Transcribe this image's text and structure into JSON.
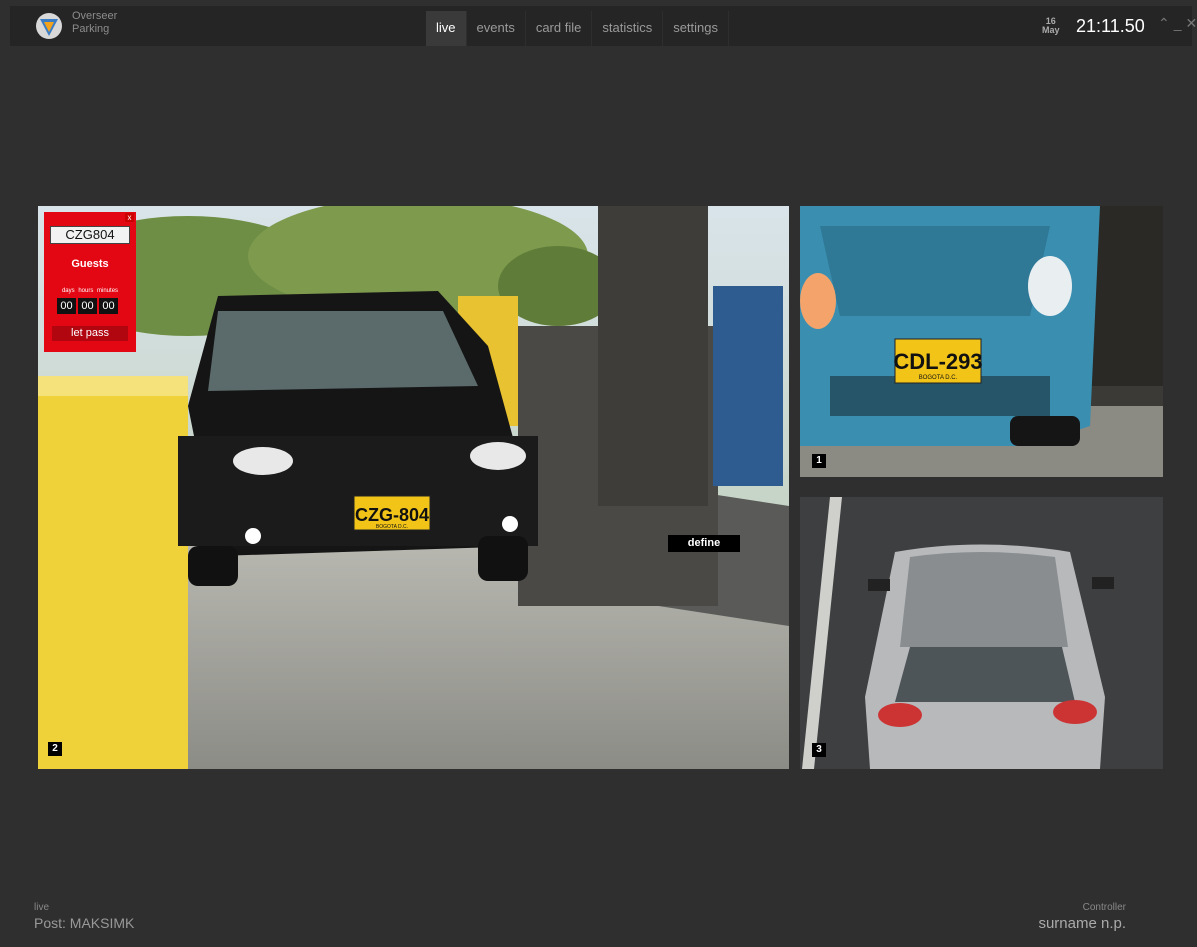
{
  "app": {
    "brand_line1": "Overseer",
    "brand_line2": "Parking",
    "logo_icon": "shield-logo-icon"
  },
  "nav": {
    "tabs": [
      {
        "label": "live",
        "active": true
      },
      {
        "label": "events",
        "active": false
      },
      {
        "label": "card file",
        "active": false
      },
      {
        "label": "statistics",
        "active": false
      },
      {
        "label": "settings",
        "active": false
      }
    ]
  },
  "datetime": {
    "day": "16",
    "month": "May",
    "time": "21:11.50"
  },
  "window_controls": {
    "collapse": "⌃",
    "minimize": "_",
    "close": "✕"
  },
  "cameras": [
    {
      "number": "2",
      "plate": "CZG-804",
      "plate_sub": "BOGOTA D.C.",
      "define_label": "define"
    },
    {
      "number": "1",
      "plate": "CDL-293",
      "plate_sub": "BOGOTA D.C."
    },
    {
      "number": "3"
    }
  ],
  "popup": {
    "close_label": "x",
    "plate": "CZG804",
    "category": "Guests",
    "units": [
      "days",
      "hours",
      "minutes"
    ],
    "timer": [
      "00",
      "00",
      "00"
    ],
    "action_label": "let pass"
  },
  "footer": {
    "mode": "live",
    "post": "Post: MAKSIMK",
    "role": "Controller",
    "user": "surname n.p."
  },
  "colors": {
    "accent_red": "#e30613",
    "plate_yellow": "#f2c418",
    "background": "#2f2f2f"
  }
}
